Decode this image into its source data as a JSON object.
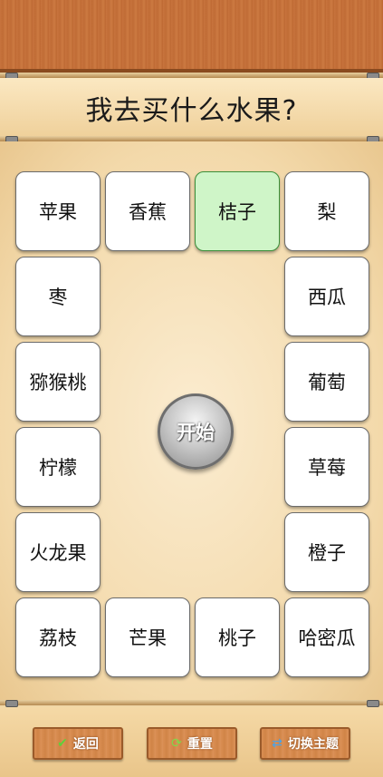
{
  "title": "我去买什么水果?",
  "tiles": [
    "苹果",
    "香蕉",
    "桔子",
    "梨",
    "枣",
    "西瓜",
    "猕猴桃",
    "葡萄",
    "柠檬",
    "草莓",
    "火龙果",
    "橙子",
    "荔枝",
    "芒果",
    "桃子",
    "哈密瓜"
  ],
  "selected_tile": "桔子",
  "start_label": "开始",
  "footer": {
    "back_label": "返回",
    "reset_label": "重置",
    "theme_label": "切换主题"
  },
  "colors": {
    "selected_bg": "#cff5c8",
    "wood": "#c8743d"
  }
}
